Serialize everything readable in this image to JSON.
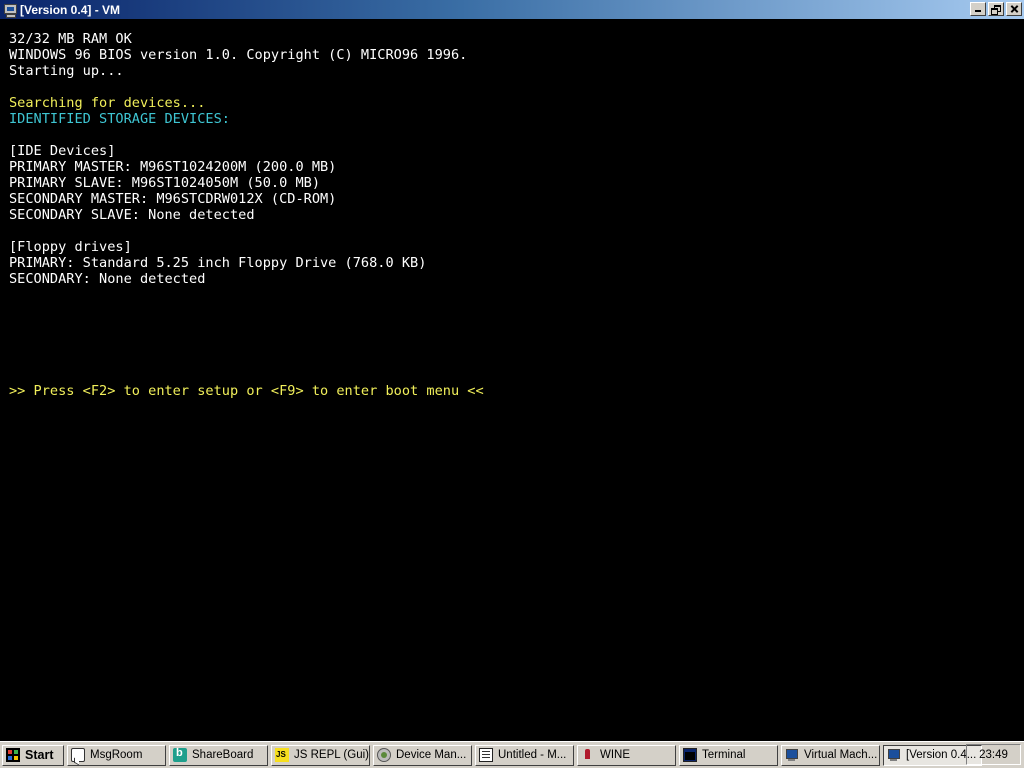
{
  "window": {
    "title": "[Version 0.4] - VM",
    "icon": "vm-monitor-icon"
  },
  "console": {
    "lines": [
      {
        "text": "32/32 MB RAM OK",
        "color": "white"
      },
      {
        "text": "WINDOWS 96 BIOS version 1.0. Copyright (C) MICRO96 1996.",
        "color": "white"
      },
      {
        "text": "Starting up...",
        "color": "white"
      },
      {
        "text": "",
        "color": "white"
      },
      {
        "text": "Searching for devices...",
        "color": "yellow"
      },
      {
        "text": "IDENTIFIED STORAGE DEVICES:",
        "color": "cyan"
      },
      {
        "text": "",
        "color": "white"
      },
      {
        "text": "[IDE Devices]",
        "color": "white"
      },
      {
        "text": "PRIMARY MASTER: M96ST1024200M (200.0 MB)",
        "color": "white"
      },
      {
        "text": "PRIMARY SLAVE: M96ST1024050M (50.0 MB)",
        "color": "white"
      },
      {
        "text": "SECONDARY MASTER: M96STCDRW012X (CD-ROM)",
        "color": "white"
      },
      {
        "text": "SECONDARY SLAVE: None detected",
        "color": "white"
      },
      {
        "text": "",
        "color": "white"
      },
      {
        "text": "[Floppy drives]",
        "color": "white"
      },
      {
        "text": "PRIMARY: Standard 5.25 inch Floppy Drive (768.0 KB)",
        "color": "white"
      },
      {
        "text": "SECONDARY: None detected",
        "color": "white"
      },
      {
        "text": "",
        "color": "white"
      },
      {
        "text": "",
        "color": "white"
      },
      {
        "text": "",
        "color": "white"
      },
      {
        "text": "",
        "color": "white"
      },
      {
        "text": "",
        "color": "white"
      },
      {
        "text": "",
        "color": "white"
      },
      {
        "text": ">> Press <F2> to enter setup or <F9> to enter boot menu <<",
        "color": "yellow"
      }
    ],
    "colors": {
      "white": "#ffffff",
      "yellow": "#f1ef5a",
      "cyan": "#3ec5d2",
      "background": "#000000"
    }
  },
  "taskbar": {
    "start_label": "Start",
    "buttons": [
      {
        "label": "MsgRoom",
        "icon": "msgroom-icon",
        "active": false
      },
      {
        "label": "ShareBoard",
        "icon": "shareboard-icon",
        "active": false
      },
      {
        "label": "JS REPL (Gui)",
        "icon": "js-repl-icon",
        "active": false
      },
      {
        "label": "Device Man...",
        "icon": "device-manager-icon",
        "active": false
      },
      {
        "label": "Untitled - M...",
        "icon": "notepad-icon",
        "active": false
      },
      {
        "label": "WINE",
        "icon": "wine-icon",
        "active": false
      },
      {
        "label": "Terminal",
        "icon": "terminal-icon",
        "active": false
      },
      {
        "label": "Virtual Mach...",
        "icon": "virtual-machine-icon",
        "active": false
      },
      {
        "label": "[Version 0.4...",
        "icon": "vm-window-icon",
        "active": true
      }
    ],
    "clock": "23:49"
  }
}
